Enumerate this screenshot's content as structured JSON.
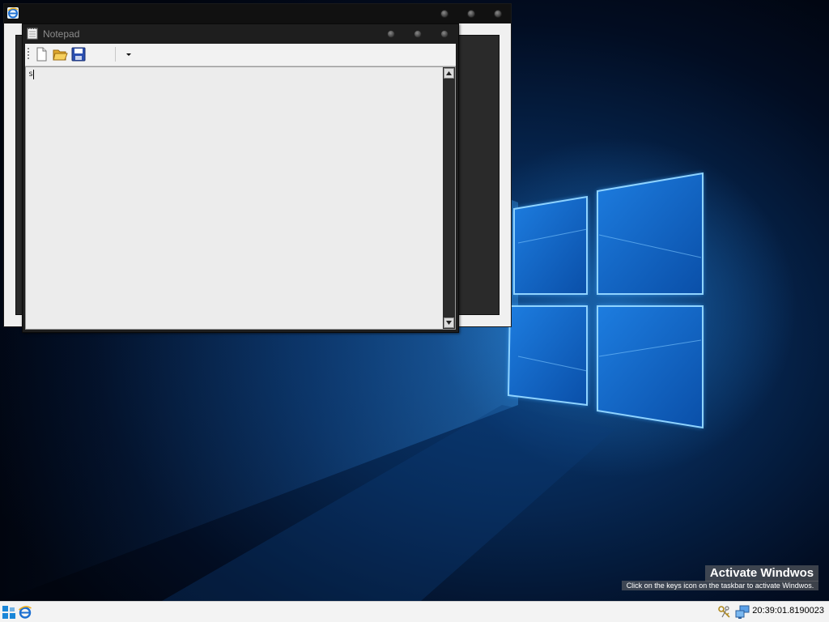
{
  "notepad": {
    "title": "Notepad",
    "editor_text": "s"
  },
  "background_window": {
    "icon": "ie-icon"
  },
  "watermark": {
    "title": "Activate Windwos",
    "subtitle": "Click on the keys icon on the taskbar to activate Windwos."
  },
  "taskbar": {
    "clock": "20:39:01.8190023",
    "icons": [
      "start-icon",
      "ie-icon",
      "keys-icon",
      "network-icon"
    ]
  },
  "colors": {
    "wallpaper_glow": "#2f9cf0",
    "titlebar": "#1e1e1e"
  }
}
